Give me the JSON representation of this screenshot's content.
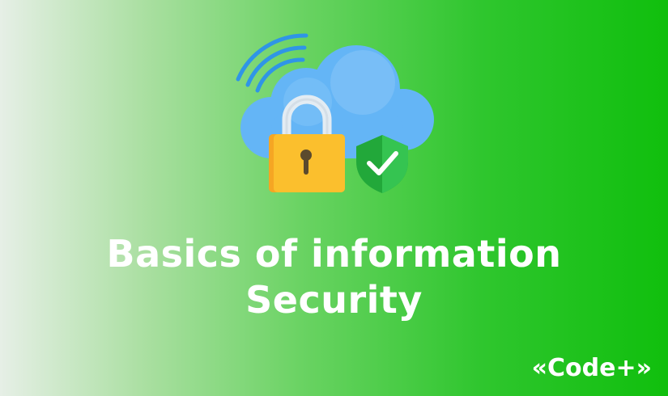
{
  "banner": {
    "title_line1": "Basics of information",
    "title_line2": "Security",
    "logo_text": "«Code+»",
    "illustration": {
      "icons": [
        "wifi-signal-icon",
        "cloud-icon",
        "padlock-icon",
        "shield-check-icon"
      ],
      "colors": {
        "cloud": "#64b5f6",
        "cloud_light": "#90caf9",
        "wifi": "#2f95e6",
        "lock_body": "#fbbf2d",
        "lock_body_shade": "#f5a623",
        "lock_shackle": "#e3ecf3",
        "keyhole": "#5b4a2d",
        "shield": "#22a83a",
        "shield_light": "#35c451",
        "check": "#ffffff"
      }
    },
    "background": {
      "gradient_start": "#e6efe6",
      "gradient_end": "#10bf0d"
    }
  }
}
